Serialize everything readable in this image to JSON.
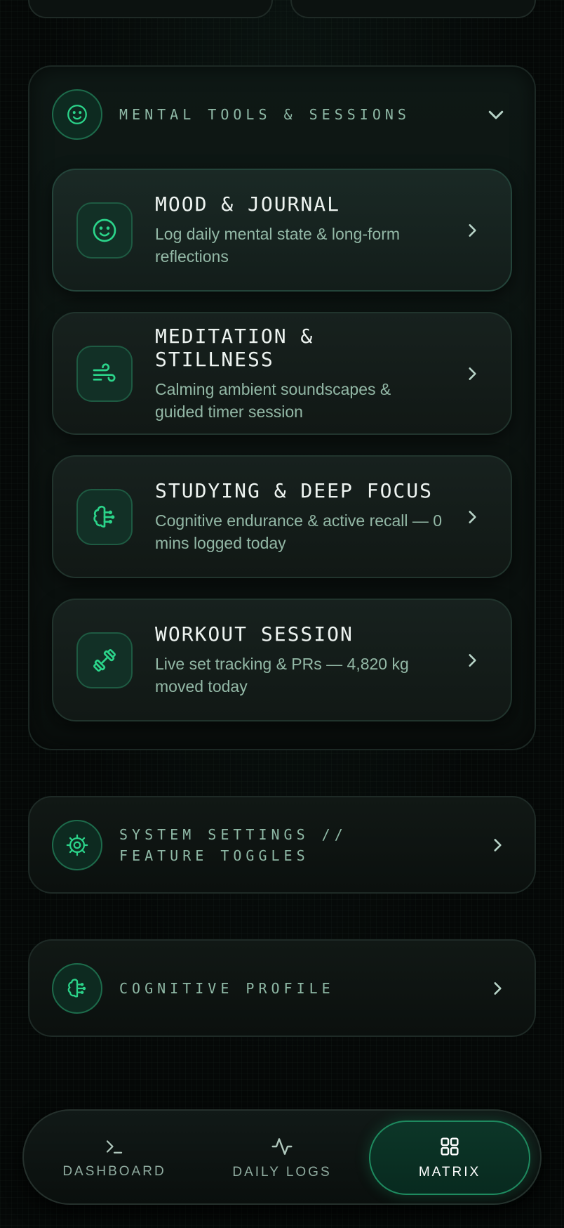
{
  "section": {
    "title": "MENTAL TOOLS & SESSIONS",
    "icon": "smile-icon"
  },
  "tools": [
    {
      "title": "MOOD & JOURNAL",
      "desc": "Log daily mental state & long-form reflections",
      "icon": "smile-icon"
    },
    {
      "title": "MEDITATION & STILLNESS",
      "desc": "Calming ambient soundscapes & guided timer session",
      "icon": "wind-icon"
    },
    {
      "title": "STUDYING & DEEP FOCUS",
      "desc": "Cognitive endurance & active recall — 0 mins logged today",
      "icon": "brain-icon"
    },
    {
      "title": "WORKOUT SESSION",
      "desc": "Live set tracking & PRs — 4,820 kg moved today",
      "icon": "dumbbell-icon"
    }
  ],
  "nav_items": [
    {
      "label": "SYSTEM SETTINGS // FEATURE TOGGLES",
      "icon": "settings-icon"
    },
    {
      "label": "COGNITIVE PROFILE",
      "icon": "brain-icon"
    }
  ],
  "tabbar": {
    "tabs": [
      {
        "label": "DASHBOARD",
        "icon": "terminal-icon"
      },
      {
        "label": "DAILY LOGS",
        "icon": "activity-icon"
      },
      {
        "label": "MATRIX",
        "icon": "grid-icon"
      }
    ],
    "active": "MATRIX"
  },
  "colors": {
    "accent": "#2bd48a",
    "background": "#050807",
    "text_muted": "#93b8a6"
  }
}
